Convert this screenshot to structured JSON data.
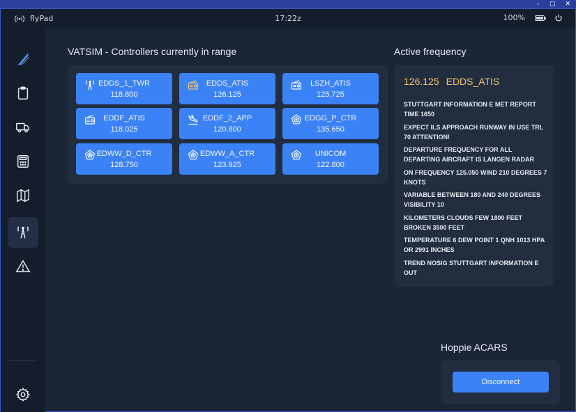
{
  "window": {
    "minimize": "–",
    "maximize": "□",
    "close": "✕"
  },
  "statusbar": {
    "app_name": "flyPad",
    "time": "17:22z",
    "battery_percent": "100%",
    "battery_level": 1.0
  },
  "sidebar": {
    "items": [
      {
        "name": "logo",
        "icon": "flybywire-logo-icon"
      },
      {
        "name": "dispatch",
        "icon": "clipboard-icon"
      },
      {
        "name": "ground",
        "icon": "truck-icon"
      },
      {
        "name": "performance",
        "icon": "calculator-icon"
      },
      {
        "name": "navigation",
        "icon": "map-icon"
      },
      {
        "name": "atc",
        "icon": "tower-icon",
        "active": true
      },
      {
        "name": "failures",
        "icon": "warning-icon"
      },
      {
        "name": "settings",
        "icon": "gear-icon"
      }
    ]
  },
  "vatsim": {
    "title": "VATSIM - Controllers currently in range",
    "controllers": [
      {
        "callsign": "EDDS_1_TWR",
        "frequency": "118.800",
        "icon": "tower-icon",
        "icon_color": "#ffffff"
      },
      {
        "callsign": "EDDS_ATIS",
        "frequency": "126.125",
        "icon": "radio-icon",
        "icon_color": "#f4c66a"
      },
      {
        "callsign": "LSZH_ATIS",
        "frequency": "125.725",
        "icon": "radio-icon",
        "icon_color": "#ffffff"
      },
      {
        "callsign": "EDDF_ATIS",
        "frequency": "118.025",
        "icon": "radio-icon",
        "icon_color": "#ffffff"
      },
      {
        "callsign": "EDDF_2_APP",
        "frequency": "120.800",
        "icon": "landing-icon",
        "icon_color": "#ffffff"
      },
      {
        "callsign": "EDGG_P_CTR",
        "frequency": "135.650",
        "icon": "radar-icon",
        "icon_color": "#ffffff"
      },
      {
        "callsign": "EDWW_D_CTR",
        "frequency": "128.750",
        "icon": "radar-icon",
        "icon_color": "#ffffff"
      },
      {
        "callsign": "EDWW_A_CTR",
        "frequency": "123.925",
        "icon": "radar-icon",
        "icon_color": "#ffffff"
      },
      {
        "callsign": "UNICOM",
        "frequency": "122.800",
        "icon": "radar-icon",
        "icon_color": "#ffffff"
      }
    ]
  },
  "active_frequency": {
    "title": "Active frequency",
    "frequency": "126.125",
    "callsign": "EDDS_ATIS",
    "metar_lines": [
      "STUTTGART INFORMATION E MET REPORT TIME 1650",
      "EXPECT ILS APPROACH RUNWAY IN USE TRL 70 ATTENTION!",
      "DEPARTURE FREQUENCY FOR ALL DEPARTING AIRCRAFT IS LANGEN RADAR",
      "ON FREQUENCY 125.050 WIND 210 DEGREES 7 KNOTS",
      "VARIABLE BETWEEN 180 AND 240 DEGREES VISIBILITY 10",
      "KILOMETERS CLOUDS FEW 1800 FEET BROKEN 3500 FEET",
      "TEMPERATURE 6 DEW POINT 1 QNH 1013 HPA OR 2991 INCHES",
      "TREND NOSIG STUTTGART INFORMATION E OUT"
    ]
  },
  "hoppie": {
    "title": "Hoppie ACARS",
    "disconnect_label": "Disconnect"
  },
  "colors": {
    "accent": "#3b82f6",
    "frequency_highlight": "#f4c66a",
    "background": "#1b2538",
    "panel": "#222d40",
    "sidebar": "#141d2c"
  }
}
